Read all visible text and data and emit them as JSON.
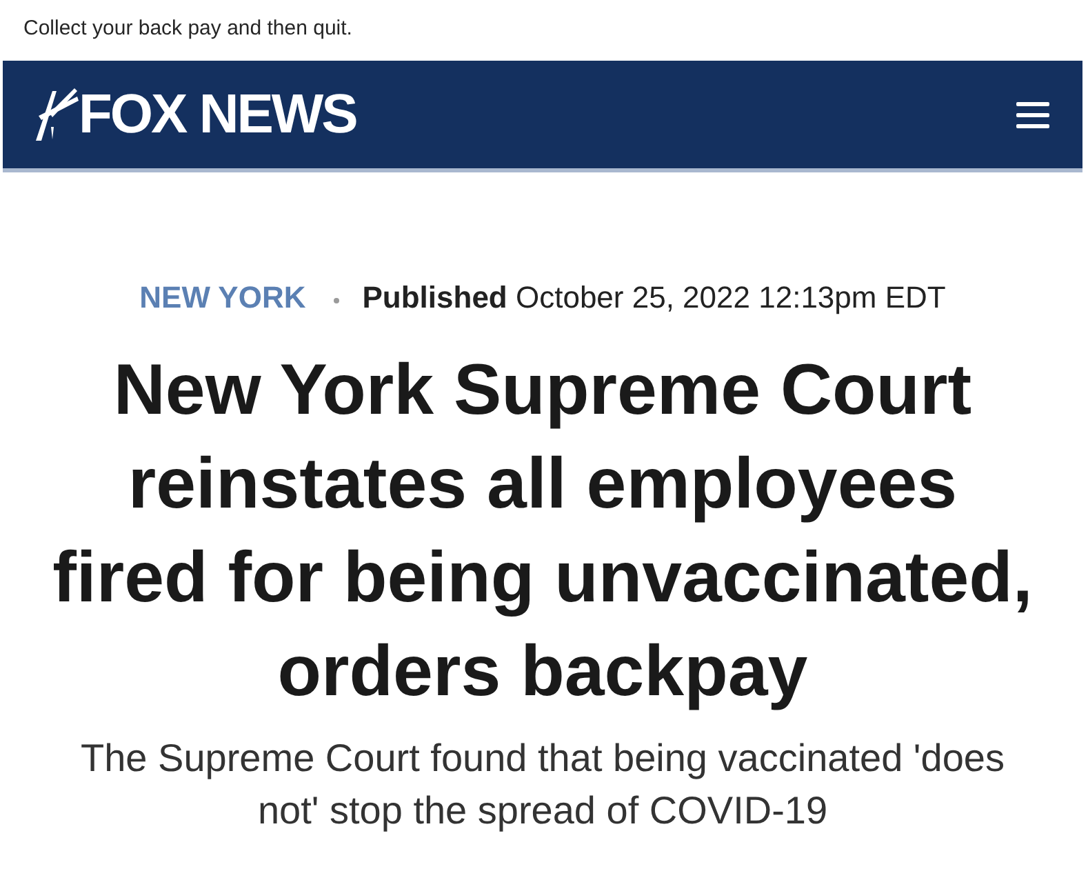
{
  "caption": "Collect your back pay and then quit.",
  "header": {
    "logo": "FOX NEWS"
  },
  "article": {
    "location": "NEW YORK",
    "published": "**Published** October 25, 2022 12:13pm EDT",
    "headline": "New York Supreme Court reinstates all employees fired for being unvaccinated, orders backpay",
    "subtitle": "The Supreme Court found that being vaccinated 'does not' stop the spread of COVID-19"
  }
}
